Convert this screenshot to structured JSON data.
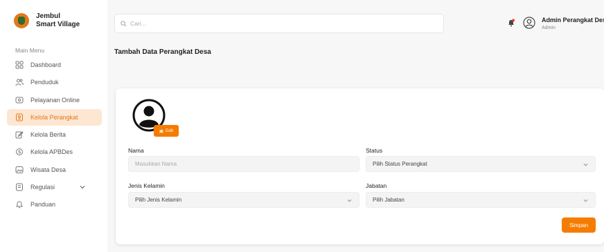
{
  "brand": {
    "line1": "Jembul",
    "line2": "Smart Village"
  },
  "sidebar": {
    "section_title": "Main Menu",
    "items": [
      {
        "label": "Dashboard",
        "icon": "grid-icon"
      },
      {
        "label": "Penduduk",
        "icon": "users-icon"
      },
      {
        "label": "Pelayanan Online",
        "icon": "service-icon"
      },
      {
        "label": "Kelola Perangkat",
        "icon": "id-card-icon",
        "active": true
      },
      {
        "label": "Kelola Berita",
        "icon": "edit-icon"
      },
      {
        "label": "Kelola APBDes",
        "icon": "money-icon"
      },
      {
        "label": "Wisata Desa",
        "icon": "image-icon"
      },
      {
        "label": "Regulasi",
        "icon": "document-icon",
        "has_submenu": true
      },
      {
        "label": "Panduan",
        "icon": "bell-icon"
      }
    ]
  },
  "search": {
    "placeholder": "Cari..."
  },
  "user": {
    "name": "Admin Perangkat Des",
    "role": "Admin"
  },
  "page": {
    "title": "Tambah Data Perangkat Desa"
  },
  "form": {
    "edit_label": "Edit",
    "nama": {
      "label": "Nama",
      "placeholder": "Masukkan Nama"
    },
    "status": {
      "label": "Status",
      "value": "Pilih Status Perangkat"
    },
    "jenis_kelamin": {
      "label": "Jenis Kelamin",
      "value": "Pilih Jenis Kelamin"
    },
    "jabatan": {
      "label": "Jabatan",
      "value": "Pilih Jabatan"
    },
    "save_label": "Simpan"
  },
  "colors": {
    "accent": "#f57c00",
    "active_bg": "#fde6d2",
    "active_text": "#e2791b"
  }
}
